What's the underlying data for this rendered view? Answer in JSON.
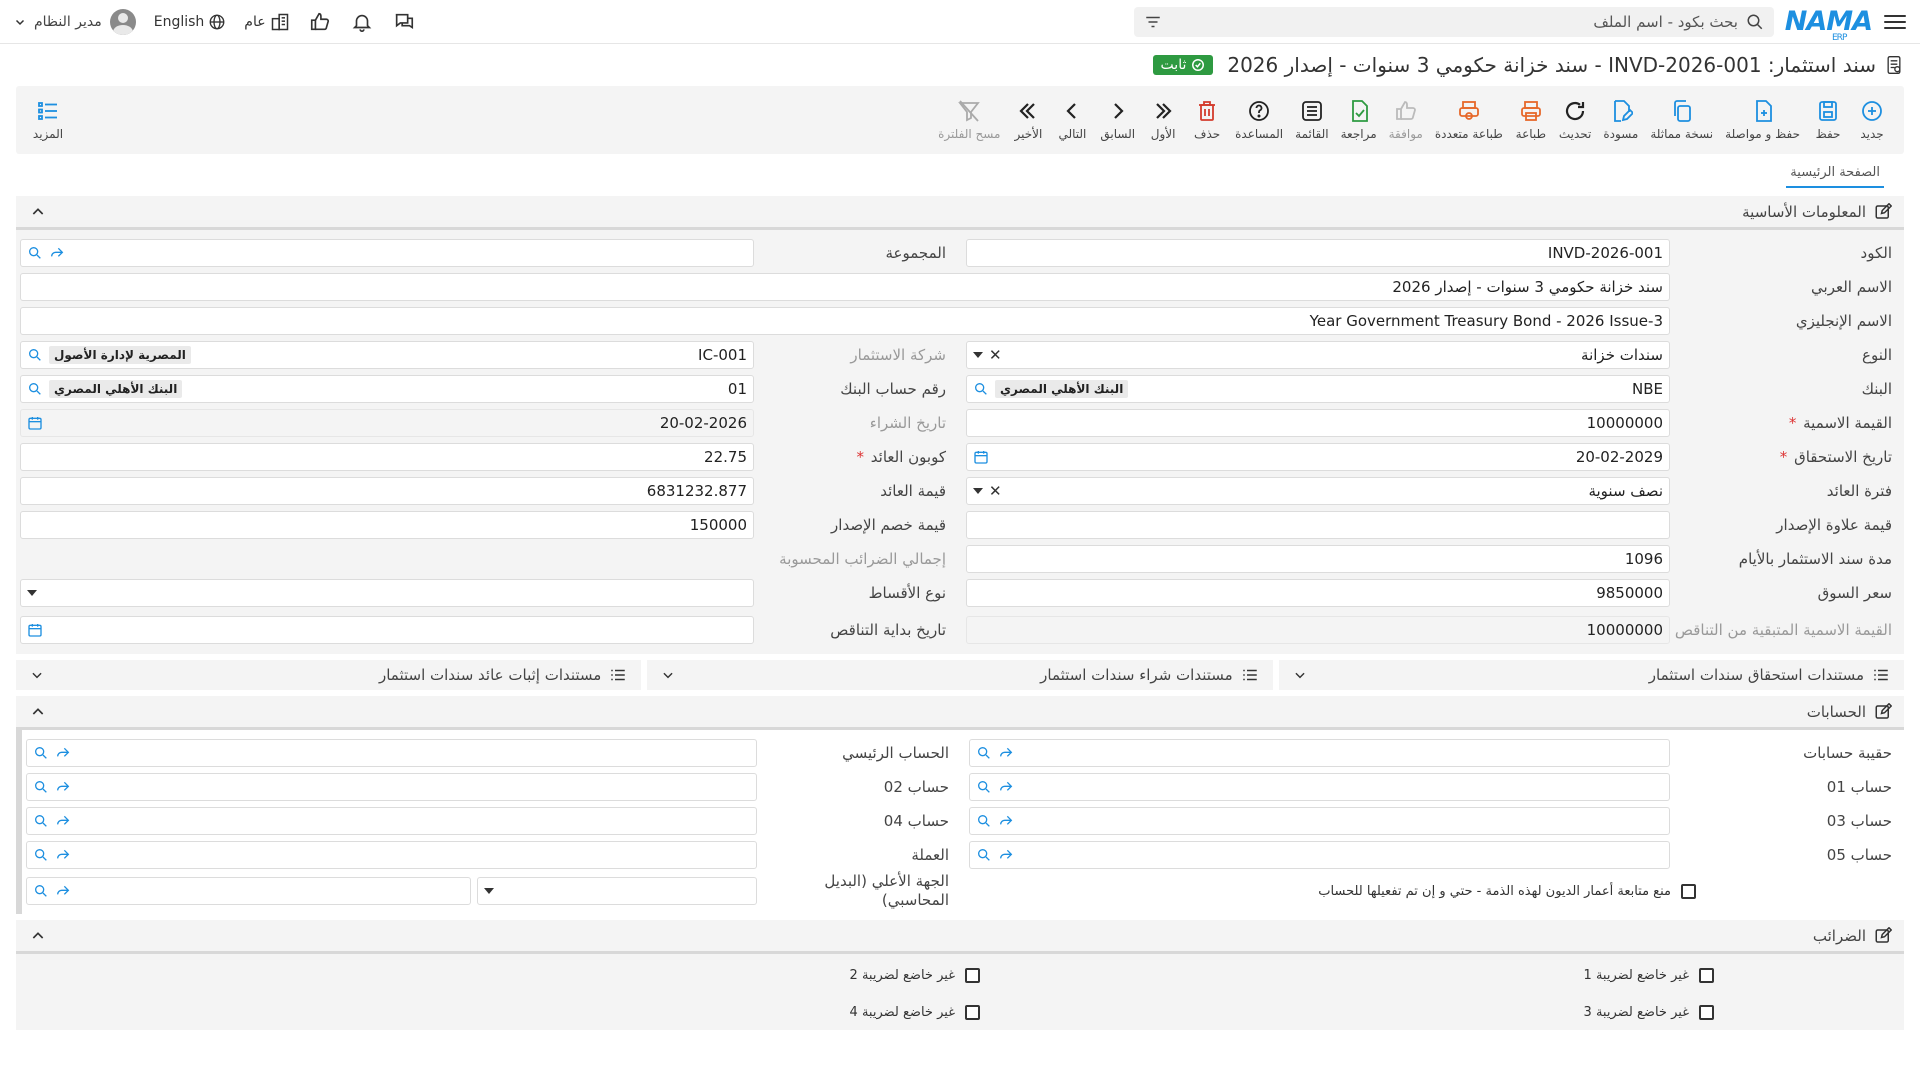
{
  "topbar": {
    "logo_text": "NAMA",
    "logo_sub": "ERP",
    "search_placeholder": "بحث بكود - اسم الملف",
    "lang_label": "English",
    "scope_label": "عام",
    "user_name": "مدير النظام"
  },
  "title": {
    "text": "سند استثمار: INVD-2026-001 - سند خزانة حكومي 3 سنوات - إصدار 2026",
    "status": "ثابت"
  },
  "toolbar": {
    "new": "جديد",
    "save": "حفظ",
    "save_continue": "حفظ و مواصلة",
    "duplicate": "نسخة مماثلة",
    "draft": "مسودة",
    "refresh": "تحديث",
    "print": "طباعة",
    "multi_print": "طباعة متعددة",
    "approve": "موافقة",
    "review": "مراجعة",
    "list": "القائمة",
    "help": "المساعدة",
    "delete": "حذف",
    "first": "الأول",
    "previous": "السابق",
    "next": "التالي",
    "last": "الأخير",
    "clear_filter": "مسح الفلترة",
    "more": "المزيد"
  },
  "tabs": {
    "main": "الصفحة الرئيسية"
  },
  "basic": {
    "title": "المعلومات الأساسية",
    "code_label": "الكود",
    "code": "INVD-2026-001",
    "group_label": "المجموعة",
    "arabic_name_label": "الاسم العربي",
    "arabic_name": "سند خزانة حكومي 3 سنوات - إصدار 2026",
    "english_name_label": "الاسم الإنجليزي",
    "english_name": "Year Government Treasury Bond - 2026 Issue-3",
    "type_label": "النوع",
    "type": "سندات خزانة",
    "company_label": "شركة الاستثمار",
    "company_code": "IC-001",
    "company_name": "المصرية لإدارة الأصول",
    "bank_label": "البنك",
    "bank_code": "NBE",
    "bank_name": "البنك الأهلي المصري",
    "bank_account_label": "رقم حساب البنك",
    "bank_account_code": "01",
    "bank_account_name": "البنك الأهلي المصري",
    "nominal_label": "القيمة الاسمية",
    "nominal": "10000000",
    "purchase_date_label": "تاريخ الشراء",
    "purchase_date": "20-02-2026",
    "maturity_label": "تاريخ الاستحقاق",
    "maturity": "20-02-2029",
    "coupon_label": "كوبون العائد",
    "coupon": "22.75",
    "period_label": "فترة العائد",
    "period": "نصف سنوية",
    "yield_value_label": "قيمة العائد",
    "yield_value": "6831232.877",
    "premium_label": "قيمة علاوة الإصدار",
    "premium": "",
    "discount_label": "قيمة خصم الإصدار",
    "discount": "150000",
    "duration_label": "مدة سند الاستثمار بالأيام",
    "duration": "1096",
    "taxes_total_label": "إجمالي الضرائب المحسوبة",
    "taxes_total": "",
    "market_price_label": "سعر السوق",
    "market_price": "9850000",
    "installment_type_label": "نوع الأقساط",
    "installment_type": "",
    "remaining_nominal_label": "القيمة الاسمية المتبقية من التناقص",
    "remaining_nominal": "10000000",
    "decline_start_label": "تاريخ بداية التناقص",
    "decline_start": ""
  },
  "subpanels": {
    "maturity_docs": "مستندات استحقاق سندات استثمار",
    "purchase_docs": "مستندات شراء سندات استثمار",
    "yield_docs": "مستندات إثبات عائد سندات استثمار"
  },
  "accounts": {
    "title": "الحسابات",
    "bag_label": "حقيبة حسابات",
    "main_label": "الحساب الرئيسي",
    "acc01_label": "حساب 01",
    "acc02_label": "حساب 02",
    "acc03_label": "حساب 03",
    "acc04_label": "حساب 04",
    "acc05_label": "حساب 05",
    "currency_label": "العملة",
    "block_debt_label": "منع متابعة أعمار الديون لهذه الذمة - حتي و إن تم تفعيلها للحساب",
    "parent_label": "الجهة الأعلي (البديل المحاسبي)"
  },
  "taxes": {
    "title": "الضرائب",
    "tax1": "غير خاضع لضريبة 1",
    "tax2": "غير خاضع لضريبة 2",
    "tax3": "غير خاضع لضريبة 3",
    "tax4": "غير خاضع لضريبة 4"
  },
  "colors": {
    "brand": "#1d8fe0",
    "status": "#2e9a41",
    "danger": "#d33b2c",
    "orange": "#e6682a"
  }
}
